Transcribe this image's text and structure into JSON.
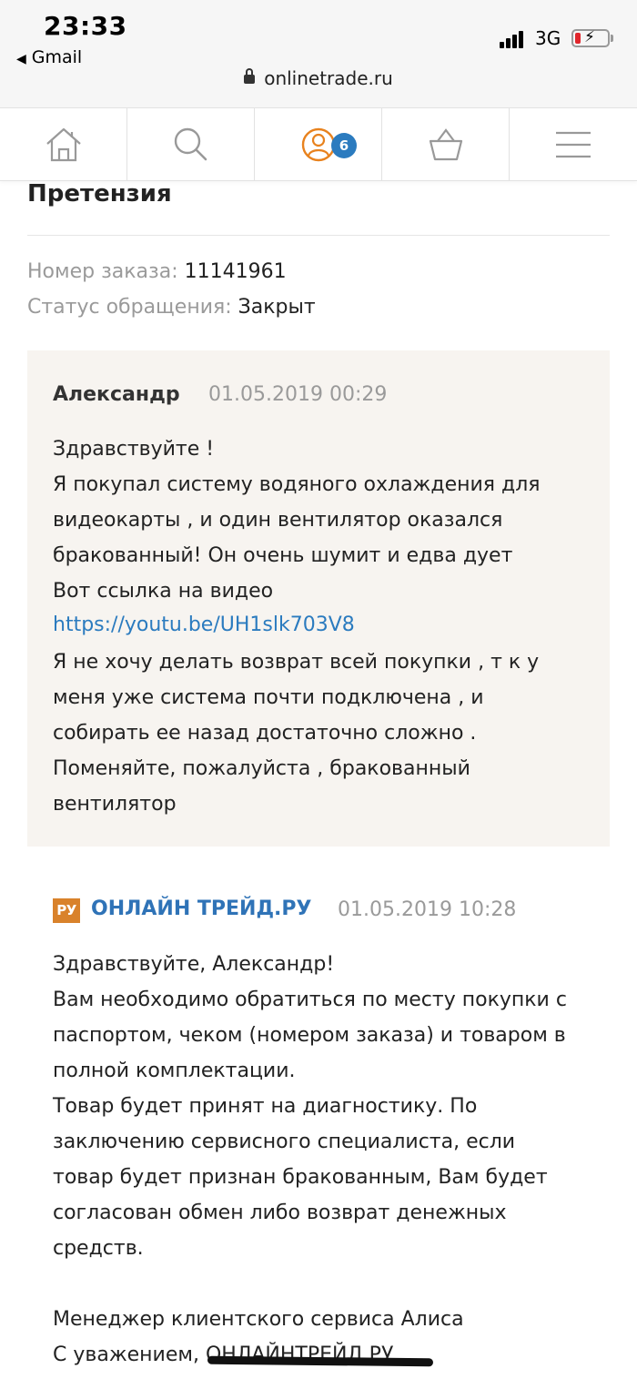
{
  "status_bar": {
    "time": "23:33",
    "back_app": "Gmail",
    "network": "3G",
    "url": "onlinetrade.ru"
  },
  "nav": {
    "items": [
      {
        "name": "home-icon"
      },
      {
        "name": "search-icon"
      },
      {
        "name": "account-icon"
      },
      {
        "name": "cart-icon"
      },
      {
        "name": "menu-icon"
      }
    ],
    "account_badge": "6"
  },
  "page": {
    "title": "Претензия",
    "order_label": "Номер заказа:",
    "order_value": "11141961",
    "status_label": "Статус обращения:",
    "status_value": "Закрыт"
  },
  "messages": [
    {
      "author": "Александр",
      "date": "01.05.2019 00:29",
      "text_before_link": "Здравствуйте !\nЯ покупал систему водяного охлаждения для\nвидеокарты , и один вентилятор оказался\nбракованный! Он очень шумит и едва дует\nВот ссылка на видео",
      "link": "https://youtu.be/UH1slk703V8",
      "text_after_link": "Я не хочу делать возврат всей покупки , т к у\nменя уже система почти подключена , и\nсобирать ее назад достаточно сложно .\nПоменяйте, пожалуйста , бракованный\nвентилятор"
    },
    {
      "logo_text": "РУ",
      "author": "ОНЛАЙН ТРЕЙД.РУ",
      "date": "01.05.2019 10:28",
      "text": "Здравствуйте, Александр!\nВам необходимо обратиться по месту покупки с\nпаспортом, чеком (номером заказа) и товаром в\nполной комплектации.\nТовар будет принят на диагностику. По\nзаключению сервисного специалиста, если\nтовар будет признан бракованным, Вам будет\nсогласован обмен либо возврат денежных\nсредств.\n\nМенеджер клиентского сервиса Алиса\nС уважением, ОНЛАЙНТРЕЙД.РУ"
    }
  ],
  "colors": {
    "accent_orange": "#e8821e",
    "link_blue": "#2b7bbf",
    "message_bg": "#f7f4f0"
  }
}
